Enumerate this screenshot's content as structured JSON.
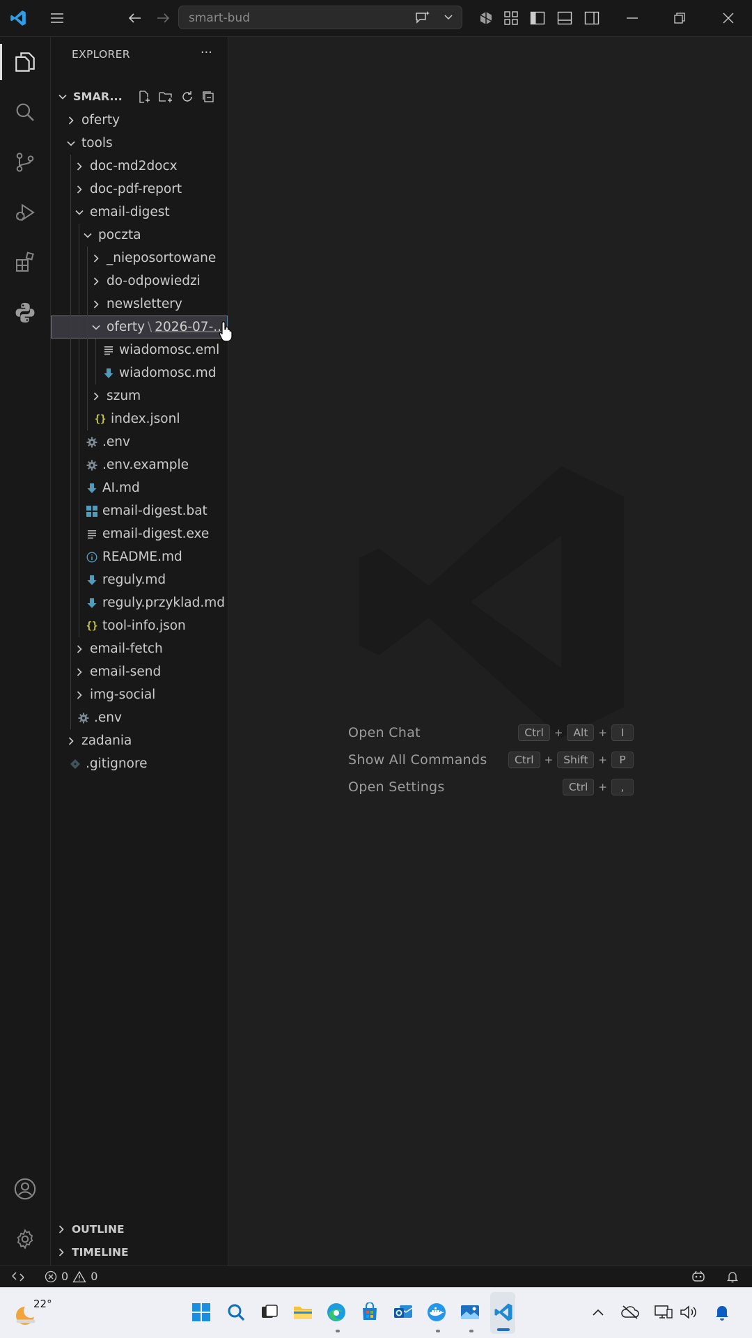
{
  "titlebar": {
    "search_text": "smart-bud"
  },
  "sidebar": {
    "title": "EXPLORER",
    "more": "···",
    "root": {
      "label": "SMAR..."
    },
    "tree": [
      {
        "label": "oferty",
        "depth": 1,
        "kind": "folder",
        "expanded": false
      },
      {
        "label": "tools",
        "depth": 1,
        "kind": "folder",
        "expanded": true
      },
      {
        "label": "doc-md2docx",
        "depth": 2,
        "kind": "folder",
        "expanded": false
      },
      {
        "label": "doc-pdf-report",
        "depth": 2,
        "kind": "folder",
        "expanded": false
      },
      {
        "label": "email-digest",
        "depth": 2,
        "kind": "folder",
        "expanded": true
      },
      {
        "label": "poczta",
        "depth": 3,
        "kind": "folder",
        "expanded": true
      },
      {
        "label": "_nieposortowane",
        "depth": 4,
        "kind": "folder",
        "expanded": false
      },
      {
        "label": "do-odpowiedzi",
        "depth": 4,
        "kind": "folder",
        "expanded": false
      },
      {
        "label": "newslettery",
        "depth": 4,
        "kind": "folder",
        "expanded": false
      },
      {
        "label": "oferty",
        "path_sep": "\\",
        "path_tail": "2026-07-...",
        "depth": 4,
        "kind": "folder",
        "expanded": true,
        "selected": true
      },
      {
        "label": "wiadomosc.eml",
        "depth": 5,
        "kind": "file",
        "icon": "lines"
      },
      {
        "label": "wiadomosc.md",
        "depth": 5,
        "kind": "file",
        "icon": "md"
      },
      {
        "label": "szum",
        "depth": 4,
        "kind": "folder",
        "expanded": false
      },
      {
        "label": "index.jsonl",
        "depth": 4,
        "kind": "file",
        "icon": "json"
      },
      {
        "label": ".env",
        "depth": 3,
        "kind": "file",
        "icon": "gear"
      },
      {
        "label": ".env.example",
        "depth": 3,
        "kind": "file",
        "icon": "gear"
      },
      {
        "label": "AI.md",
        "depth": 3,
        "kind": "file",
        "icon": "md"
      },
      {
        "label": "email-digest.bat",
        "depth": 3,
        "kind": "file",
        "icon": "win"
      },
      {
        "label": "email-digest.exe",
        "depth": 3,
        "kind": "file",
        "icon": "lines"
      },
      {
        "label": "README.md",
        "depth": 3,
        "kind": "file",
        "icon": "info"
      },
      {
        "label": "reguly.md",
        "depth": 3,
        "kind": "file",
        "icon": "md"
      },
      {
        "label": "reguly.przyklad.md",
        "depth": 3,
        "kind": "file",
        "icon": "md"
      },
      {
        "label": "tool-info.json",
        "depth": 3,
        "kind": "file",
        "icon": "json"
      },
      {
        "label": "email-fetch",
        "depth": 2,
        "kind": "folder",
        "expanded": false
      },
      {
        "label": "email-send",
        "depth": 2,
        "kind": "folder",
        "expanded": false
      },
      {
        "label": "img-social",
        "depth": 2,
        "kind": "folder",
        "expanded": false
      },
      {
        "label": ".env",
        "depth": 2,
        "kind": "file",
        "icon": "gear"
      },
      {
        "label": "zadania",
        "depth": 1,
        "kind": "folder",
        "expanded": false
      },
      {
        "label": ".gitignore",
        "depth": 1,
        "kind": "file",
        "icon": "git"
      }
    ],
    "outline": "OUTLINE",
    "timeline": "TIMELINE"
  },
  "editor": {
    "shortcuts": [
      {
        "label": "Open Chat",
        "keys": [
          "Ctrl",
          "Alt",
          "I"
        ]
      },
      {
        "label": "Show All Commands",
        "keys": [
          "Ctrl",
          "Shift",
          "P"
        ]
      },
      {
        "label": "Open Settings",
        "keys": [
          "Ctrl",
          ","
        ]
      }
    ]
  },
  "statusbar": {
    "errors": "0",
    "warnings": "0"
  },
  "taskbar": {
    "weather_temp": "22°"
  },
  "colors": {
    "folder_chevron": "#cccccc",
    "md_icon": "#519aba",
    "json_icon": "#cbcb41",
    "gear_icon": "#7f8b96",
    "win_icon": "#519aba",
    "info_icon": "#519aba"
  }
}
